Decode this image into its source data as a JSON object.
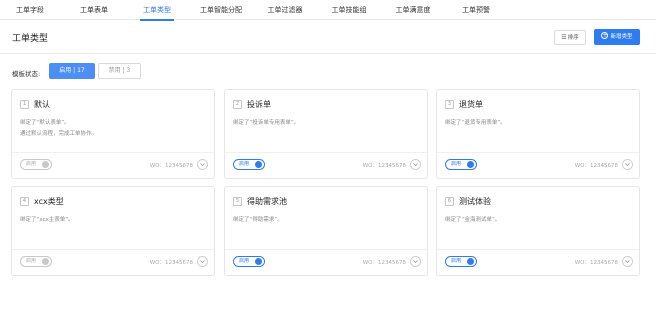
{
  "tabs": [
    {
      "label": "工单字段",
      "active": false
    },
    {
      "label": "工单表单",
      "active": false
    },
    {
      "label": "工单类型",
      "active": true
    },
    {
      "label": "工单智能分配",
      "active": false
    },
    {
      "label": "工单过滤器",
      "active": false
    },
    {
      "label": "工单技能组",
      "active": false
    },
    {
      "label": "工单满意度",
      "active": false
    },
    {
      "label": "工单预警",
      "active": false
    }
  ],
  "header": {
    "title": "工单类型",
    "sort_label": "排序",
    "new_label": "新增类型"
  },
  "filter": {
    "label": "模板状态:",
    "enabled": "启用 | 17",
    "disabled": "禁用 | 3"
  },
  "cards": [
    {
      "num": "1",
      "title": "默认",
      "desc1": "绑定了“默认表单”。",
      "desc2": "通过默认流程，完成工单协作。",
      "toggle": "启用",
      "on": false,
      "wo": "WO：12345678"
    },
    {
      "num": "2",
      "title": "投诉单",
      "desc1": "绑定了“投诉单专用表单”。",
      "desc2": "",
      "toggle": "启用",
      "on": true,
      "wo": "WO：12345678"
    },
    {
      "num": "3",
      "title": "退货单",
      "desc1": "绑定了“退货专用表单”。",
      "desc2": "",
      "toggle": "启用",
      "on": true,
      "wo": "WO：12345678"
    },
    {
      "num": "4",
      "title": "xcx类型",
      "desc1": "绑定了“xcx主表单”。",
      "desc2": "",
      "toggle": "启用",
      "on": false,
      "wo": "WO：12345678"
    },
    {
      "num": "5",
      "title": "得助需求池",
      "desc1": "绑定了“得助需求”。",
      "desc2": "",
      "toggle": "启用",
      "on": true,
      "wo": "WO：12345678"
    },
    {
      "num": "6",
      "title": "测试体验",
      "desc1": "绑定了“金海测试单”。",
      "desc2": "",
      "toggle": "启用",
      "on": true,
      "wo": "WO：12345678"
    }
  ],
  "colors": {
    "accent": "#2f7bf0",
    "toggle_off": "#c8c8c8"
  }
}
